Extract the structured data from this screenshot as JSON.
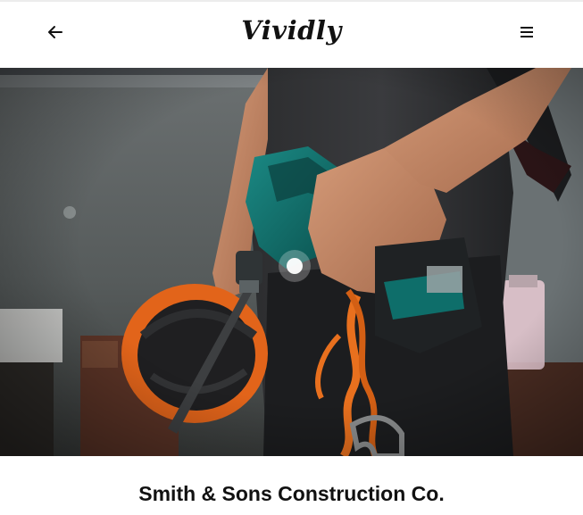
{
  "header": {
    "brand": "Vividly",
    "back_icon": "arrow-left-icon",
    "menu_icon": "hamburger-menu-icon"
  },
  "hero": {
    "subject": "construction-worker-with-impact-driver-photo"
  },
  "content": {
    "title": "Smith & Sons Construction Co."
  },
  "colors": {
    "text": "#111111",
    "background": "#ffffff",
    "drill_teal": "#0e6e6a",
    "rope_orange": "#e8701e",
    "helmet_orange": "#e2641a"
  }
}
